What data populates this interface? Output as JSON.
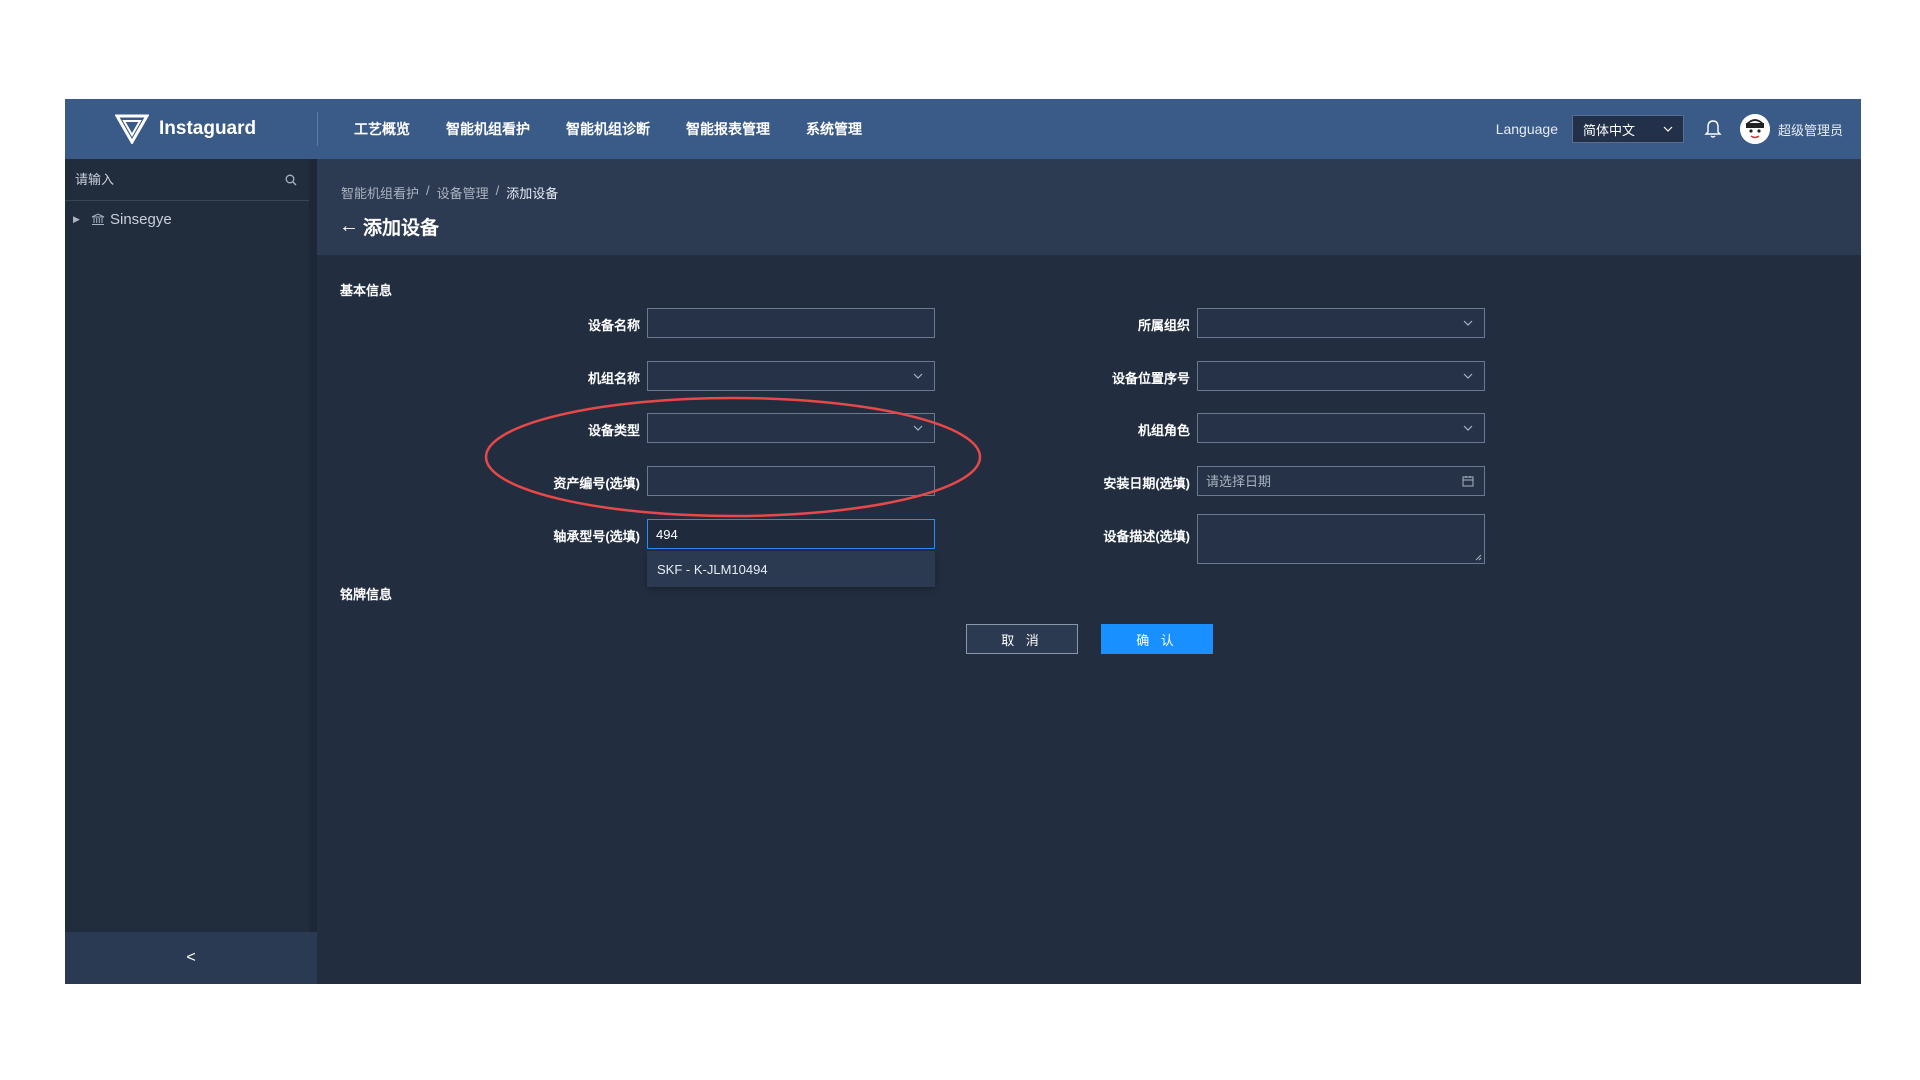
{
  "app": {
    "brand": "Instaguard",
    "nav": [
      "工艺概览",
      "智能机组看护",
      "智能机组诊断",
      "智能报表管理",
      "系统管理"
    ],
    "language_label": "Language",
    "language_value": "简体中文",
    "user_name": "超级管理员"
  },
  "sidebar": {
    "search_placeholder": "请输入",
    "tree": [
      {
        "label": "Sinsegye"
      }
    ],
    "collapse_glyph": "<"
  },
  "breadcrumb": [
    "智能机组看护",
    "设备管理",
    "添加设备"
  ],
  "breadcrumb_separator": "/",
  "page_title": "添加设备",
  "form": {
    "section_basic": "基本信息",
    "section_nameplate": "铭牌信息",
    "labels": {
      "device_name": "设备名称",
      "organization": "所属组织",
      "unit_name": "机组名称",
      "position_index": "设备位置序号",
      "device_type": "设备类型",
      "unit_role": "机组角色",
      "asset_no": "资产编号(选填)",
      "install_date": "安装日期(选填)",
      "bearing_model": "轴承型号(选填)",
      "description": "设备描述(选填)"
    },
    "install_date_placeholder": "请选择日期",
    "bearing_model_value": "494",
    "bearing_suggestion": "SKF - K-JLM10494",
    "cancel_label": "取 消",
    "confirm_label": "确 认"
  },
  "colors": {
    "topbar": "#3a5a88",
    "background": "#222e40",
    "primary": "#1890ff",
    "highlight_ring": "#e84848"
  }
}
